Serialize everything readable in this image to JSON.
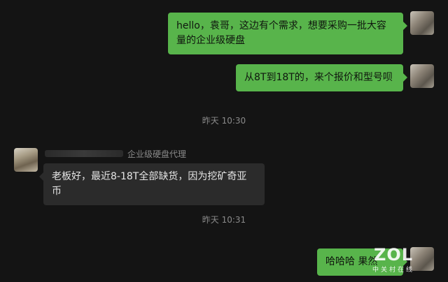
{
  "messages": {
    "m1": "hello，袁哥，这边有个需求，想要采购一批大容量的企业级硬盘",
    "m2": "从8T到18T的，来个报价和型号呗",
    "m3": "老板好，最近8-18T全部缺货，因为挖矿奇亚币",
    "m4": "哈哈哈  果然"
  },
  "timestamps": {
    "t1": "昨天 10:30",
    "t2": "昨天 10:31"
  },
  "sender": {
    "tag": "企业级硬盘代理"
  },
  "watermark": {
    "logo": "ZOL",
    "sub": "中关村在线"
  },
  "colors": {
    "background": "#141414",
    "my_bubble": "#58b44b",
    "their_bubble": "#2b2b2b",
    "meta_text": "#8a8a8a"
  }
}
